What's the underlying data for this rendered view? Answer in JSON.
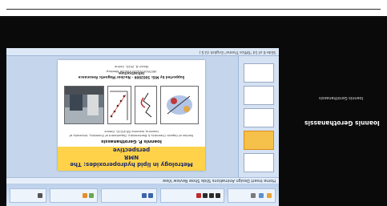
{
  "meeting": {
    "presenter_name": "Ioannis Gerothanassis",
    "participant_tile_label": "Ioannis Gerothanassis"
  },
  "powerpoint": {
    "menu": "Home  Insert  Design  Animations  Slide Show  Review  View",
    "status_text": "Slide 6 of 14   \"Office Theme\"   English (U.S.)"
  },
  "slide": {
    "title_line1": "Metrology in lipid hydroperoxides: The NMR",
    "title_line2": "perspective",
    "author": "Ioannis P. Gerothanassis",
    "affiliation": "Section of Organic Chemistry & Biochemistry, Department of Chemistry, University of Ioannina, Ioannina GR-45110, Greece",
    "sponsor": "Supported by MIS: 5002809 – Nuclear Magnetic Resonance Infrastructure",
    "meeting": "METROFOOD-RI Kick-off Meeting",
    "date": "March 8, 2022, Online"
  }
}
